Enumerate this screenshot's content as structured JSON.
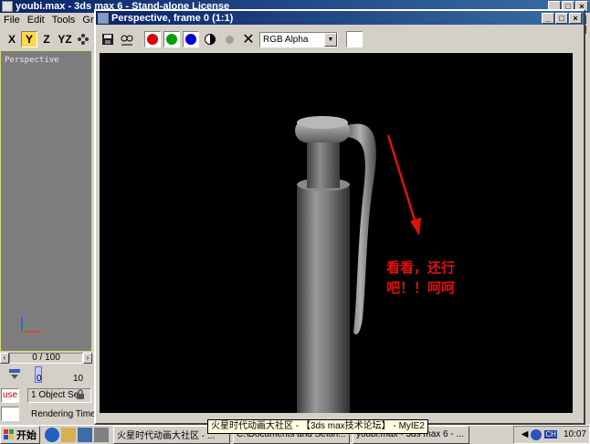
{
  "main_window": {
    "title": "youbi.max - 3ds max 6 - Stand-alone License",
    "menu": [
      "File",
      "Edit",
      "Tools",
      "Grou"
    ]
  },
  "axis_toolbar": {
    "x": "X",
    "y": "Y",
    "z": "Z",
    "yz": "YZ"
  },
  "viewport": {
    "label": "Perspective"
  },
  "timeline": {
    "frame_counter": "0 / 100",
    "tick_start": "0",
    "tick_end": "10"
  },
  "status": {
    "use_label": "use",
    "selection": "1 Object Se",
    "rendering": "Rendering Time"
  },
  "render_window": {
    "title": "Perspective, frame 0 (1:1)",
    "channel": "RGB Alpha",
    "annotation_line1": "看看，还行",
    "annotation_line2": "吧！！呵呵"
  },
  "tooltip": "火星时代动画大社区 - 【3ds max技术论坛】 - MyIE2",
  "taskbar": {
    "start": "开始",
    "tasks": [
      "火星时代动画大社区 - ...",
      "C:\\Documents and Settin...",
      "youbi.max - 3ds max 6 - ..."
    ],
    "clock": "10:07",
    "tray_ch": "CH"
  },
  "colors": {
    "red_dot": "#e00000",
    "green_dot": "#00a000",
    "blue_dot": "#0000d0",
    "annotation": "#e01010"
  }
}
